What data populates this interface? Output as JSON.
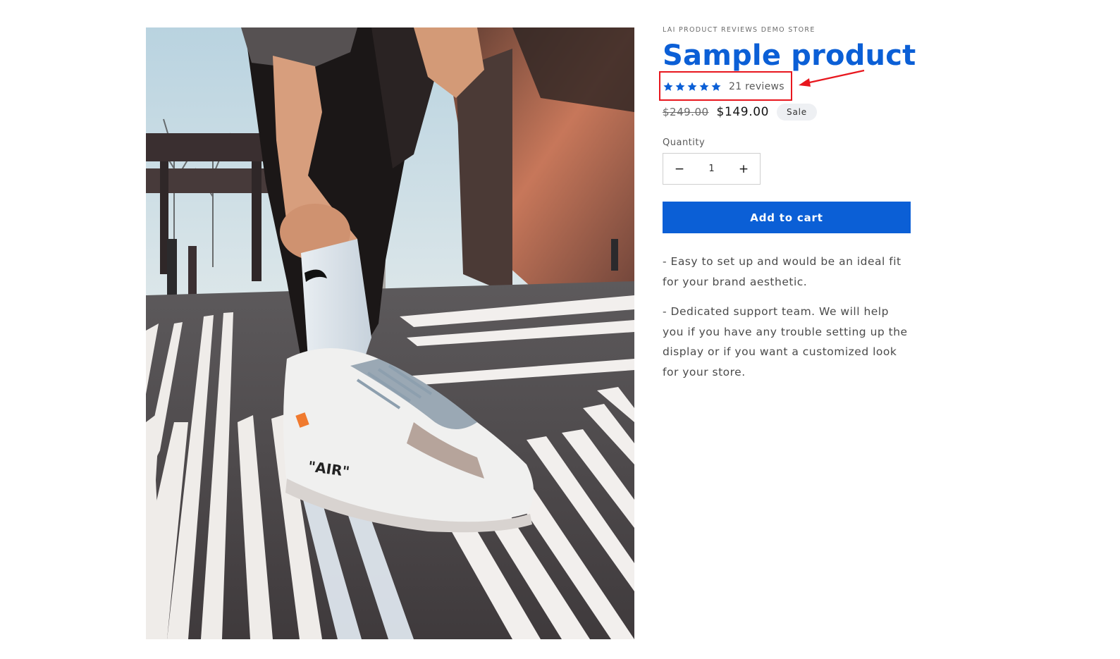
{
  "product": {
    "image_alt": "Sample product image",
    "vendor": "LAI PRODUCT REVIEWS DEMO STORE",
    "title": "Sample product",
    "rating": {
      "stars": 5,
      "max_stars": 5,
      "review_count_label": "21 reviews",
      "star_color": "#0b5fd6"
    },
    "price": {
      "compare_at": "$249.00",
      "sale": "$149.00",
      "badge": "Sale"
    },
    "quantity": {
      "label": "Quantity",
      "value": "1",
      "decrease_symbol": "−",
      "increase_symbol": "+"
    },
    "add_to_cart_label": "Add to cart",
    "description": [
      "- Easy to set up and would be an ideal fit for your brand aesthetic.",
      "- Dedicated support team. We will help you if you have any trouble setting up the display or if you want a customized look for your store."
    ]
  },
  "annotation": {
    "color": "#e8171e",
    "icons": [
      "highlight-box",
      "arrow-icon"
    ]
  },
  "colors": {
    "accent": "#0b5fd6",
    "badge_bg": "#eef0f3"
  }
}
